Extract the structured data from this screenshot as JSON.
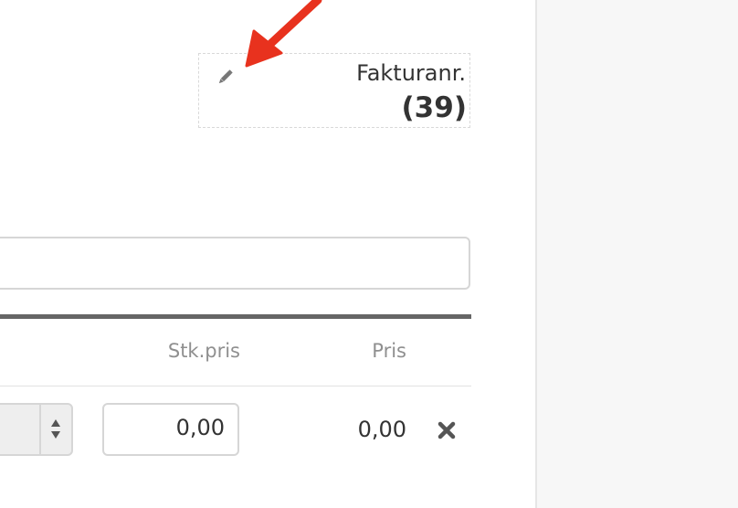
{
  "invoice": {
    "label": "Fakturanr.",
    "number": "(39)",
    "edit_icon": "pencil-icon"
  },
  "annotation": {
    "arrow_color": "#e8321e",
    "arrow_icon": "arrow-icon"
  },
  "line_items": {
    "columns": [
      "Stk.pris",
      "Pris"
    ],
    "rows": [
      {
        "unit_price_value": "0,00",
        "price": "0,00",
        "remove_icon": "close-icon"
      }
    ]
  },
  "colors": {
    "header_rule": "#666666",
    "column_header_text": "#8f8f8f",
    "side_panel": "#f7f7f7"
  }
}
